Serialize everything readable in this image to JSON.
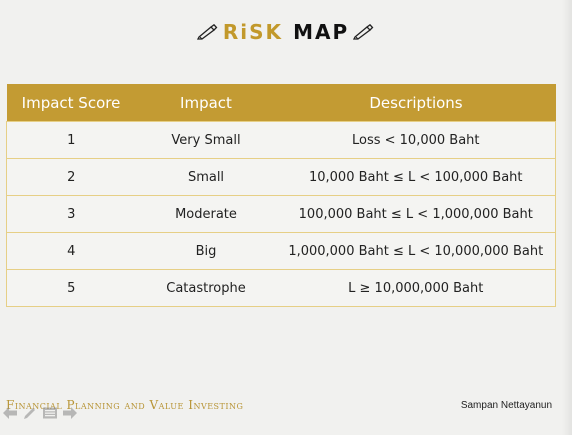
{
  "title": {
    "left": "RiSK",
    "right": "MAP"
  },
  "table": {
    "headers": [
      "Impact Score",
      "Impact",
      "Descriptions"
    ],
    "rows": [
      [
        "1",
        "Very Small",
        "Loss < 10,000 Baht"
      ],
      [
        "2",
        "Small",
        "10,000 Baht ≤ L < 100,000 Baht"
      ],
      [
        "3",
        "Moderate",
        "100,000 Baht ≤ L < 1,000,000 Baht"
      ],
      [
        "4",
        "Big",
        "1,000,000 Baht ≤ L < 10,000,000 Baht"
      ],
      [
        "5",
        "Catastrophe",
        "L ≥ 10,000,000 Baht"
      ]
    ]
  },
  "footer": {
    "left": "Financial Planning and Value Investing",
    "right": "Sampan Nettayanun"
  },
  "controls": [
    "prev-arrow-icon",
    "pen-icon",
    "slide-menu-icon",
    "next-arrow-icon"
  ],
  "colors": {
    "accent": "#c39b33",
    "border": "#e6cf86",
    "background": "#f1f1ef"
  }
}
